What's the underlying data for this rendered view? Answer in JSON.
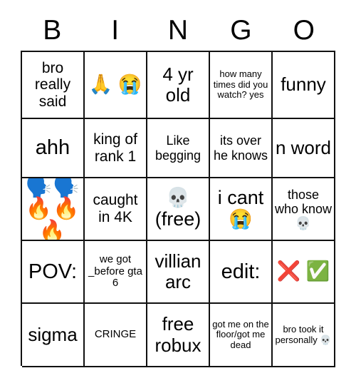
{
  "header": {
    "letters": [
      "B",
      "I",
      "N",
      "G",
      "O"
    ]
  },
  "grid": {
    "columns": 5,
    "rows": 5,
    "border_color": "#111111",
    "background_color": "#ffffff",
    "text_color": "#000000",
    "cells": [
      {
        "text": "bro really said",
        "size": "l",
        "kind": "text"
      },
      {
        "text": "🙏 😭",
        "size": "m",
        "kind": "emoji-stack"
      },
      {
        "text": "4 yr old",
        "size": "xl",
        "kind": "text"
      },
      {
        "text": "how many times did you watch? yes",
        "size": "xs",
        "kind": "text"
      },
      {
        "text": "funny",
        "size": "xl",
        "kind": "text"
      },
      {
        "text": "ahh",
        "size": "xxl",
        "kind": "text"
      },
      {
        "text": "king of rank 1",
        "size": "l",
        "kind": "text"
      },
      {
        "text": "Like begging",
        "size": "m",
        "kind": "text"
      },
      {
        "text": "its over he knows",
        "size": "m",
        "kind": "text"
      },
      {
        "text": "n word",
        "size": "xl",
        "kind": "text"
      },
      {
        "text": "🗣️🗣️ 🔥🔥 🔥",
        "size": "m",
        "kind": "emoji"
      },
      {
        "text": "caught in 4K",
        "size": "l",
        "kind": "text"
      },
      {
        "text": "💀 (free)",
        "size": "l",
        "kind": "emoji-stack"
      },
      {
        "text": "i cant 😭",
        "size": "l",
        "kind": "emoji-stack"
      },
      {
        "text": "those who know 💀",
        "size": "m",
        "kind": "text"
      },
      {
        "text": "POV:",
        "size": "xxl",
        "kind": "text"
      },
      {
        "text": "we got _before gta 6",
        "size": "s",
        "kind": "text"
      },
      {
        "text": "villian arc",
        "size": "xl",
        "kind": "text"
      },
      {
        "text": "edit:",
        "size": "xxl",
        "kind": "text"
      },
      {
        "text": "❌ ✅",
        "size": "m",
        "kind": "emoji-stack"
      },
      {
        "text": "sigma",
        "size": "xl",
        "kind": "text"
      },
      {
        "text": "CRINGE",
        "size": "s",
        "kind": "text"
      },
      {
        "text": "free robux",
        "size": "xl",
        "kind": "text"
      },
      {
        "text": "got me on the floor/got me dead",
        "size": "xs",
        "kind": "text"
      },
      {
        "text": "bro took it personally 💀",
        "size": "xs",
        "kind": "text"
      }
    ]
  }
}
